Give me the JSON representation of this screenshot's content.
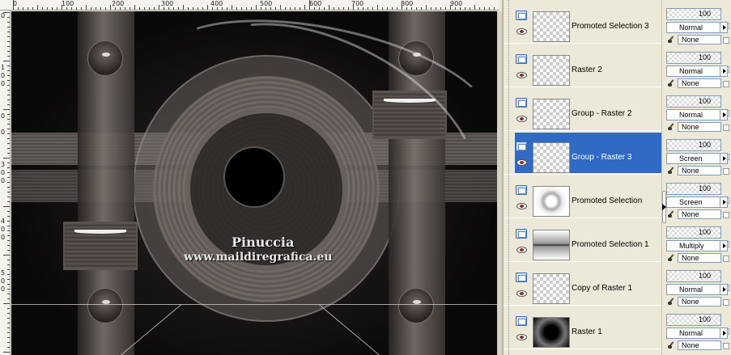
{
  "ruler": {
    "top_labels": [
      "0",
      "100",
      "200",
      "300",
      "400",
      "500",
      "600",
      "700",
      "800",
      "900"
    ],
    "left_labels": [
      "0",
      "1",
      "0",
      "0",
      "0",
      "0",
      "3",
      "0",
      "0",
      "4",
      "0",
      "0",
      "5",
      "0",
      "0"
    ]
  },
  "canvas": {
    "watermark_line1": "Pinuccia",
    "watermark_line2": "www.maildiregrafica.eu"
  },
  "layers": [
    {
      "name": "Promoted Selection 3",
      "selected": false,
      "opacity": "100",
      "blend": "Normal",
      "mask": "None"
    },
    {
      "name": "Raster 2",
      "selected": false,
      "opacity": "100",
      "blend": "Normal",
      "mask": "None"
    },
    {
      "name": "Group - Raster 2",
      "selected": false,
      "opacity": "100",
      "blend": "Normal",
      "mask": "None"
    },
    {
      "name": "Group - Raster 3",
      "selected": true,
      "opacity": "100",
      "blend": "Screen",
      "mask": "None"
    },
    {
      "name": "Promoted Selection",
      "selected": false,
      "opacity": "100",
      "blend": "Screen",
      "mask": "None"
    },
    {
      "name": "Promoted Selection 1",
      "selected": false,
      "opacity": "100",
      "blend": "Multiply",
      "mask": "None"
    },
    {
      "name": "Copy of Raster 1",
      "selected": false,
      "opacity": "100",
      "blend": "Normal",
      "mask": "None"
    },
    {
      "name": "Raster 1",
      "selected": false,
      "opacity": "100",
      "blend": "Normal",
      "mask": "None"
    }
  ],
  "colors": {
    "selection": "#316ac5",
    "panel_bg": "#ece9d8"
  }
}
